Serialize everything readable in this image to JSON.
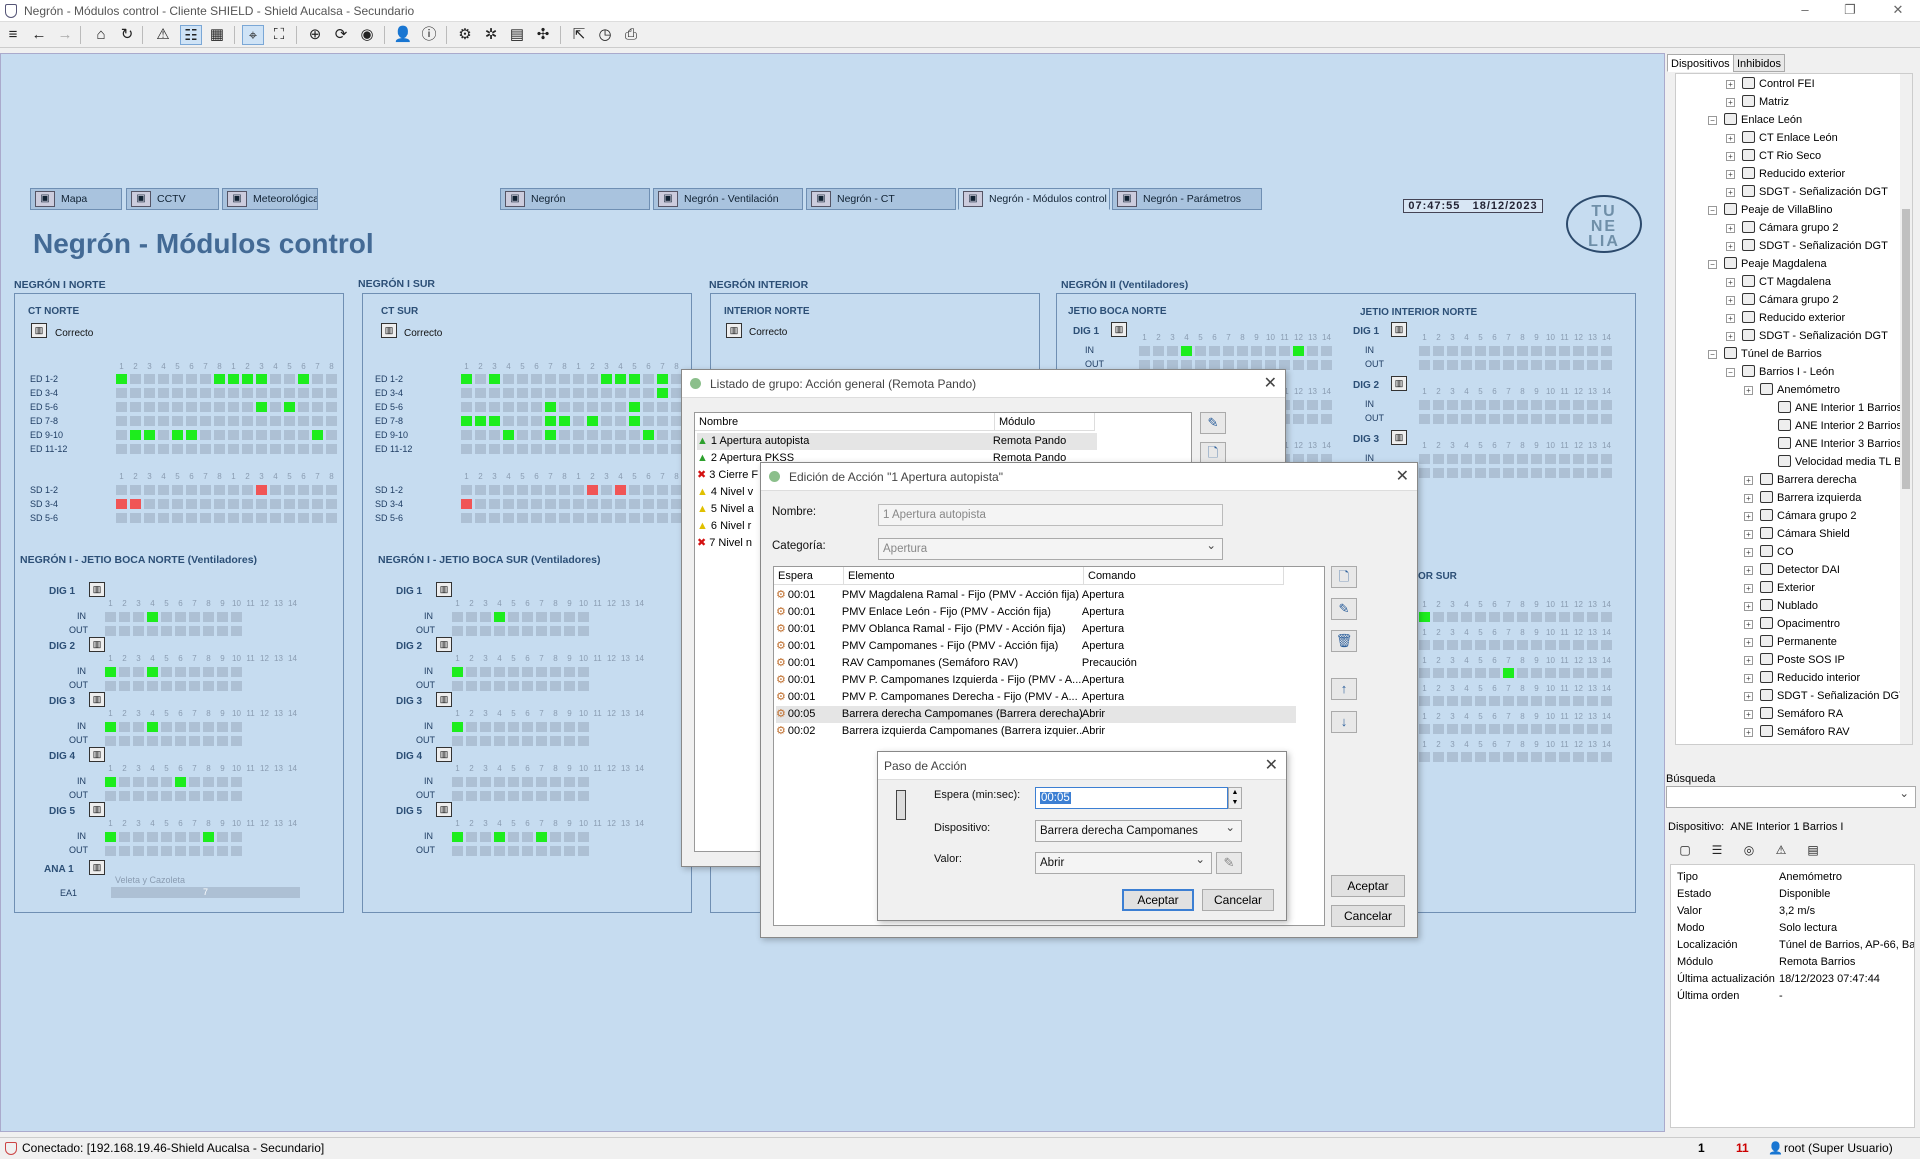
{
  "window": {
    "title": "Negrón - Módulos control - Cliente SHIELD - Shield Aucalsa - Secundario"
  },
  "tabs": [
    {
      "label": "Mapa",
      "icon": "map-icon"
    },
    {
      "label": "CCTV",
      "icon": "camera-icon"
    },
    {
      "label": "Meteorológicas",
      "icon": "weather-icon"
    },
    {
      "label": "Negrón",
      "icon": "module-icon"
    },
    {
      "label": "Negrón - Ventilación",
      "icon": "fan-icon"
    },
    {
      "label": "Negrón - CT",
      "icon": "module-icon"
    },
    {
      "label": "Negrón - Módulos control",
      "icon": "module-icon",
      "active": true
    },
    {
      "label": "Negrón - Parámetros",
      "icon": "gear-icon"
    }
  ],
  "clock": {
    "time": "07:47:55",
    "date": "18/12/2023"
  },
  "logo": {
    "line1": "TU",
    "line2": "NE",
    "line3": "LIA"
  },
  "page": {
    "title": "Negrón - Módulos control"
  },
  "sections": {
    "norte": "NEGRÓN I NORTE",
    "sur": "NEGRÓN I SUR",
    "interior": "NEGRÓN INTERIOR",
    "ventiladores": "NEGRÓN II (Ventiladores)",
    "ct_norte": "CT NORTE",
    "ct_sur": "CT SUR",
    "interior_norte": "INTERIOR NORTE",
    "jetio_boca_norte": "JETIO BOCA NORTE",
    "jetio_interior_norte": "JETIO INTERIOR NORTE",
    "jetio_boca_norte_vent": "NEGRÓN I - JETIO BOCA NORTE (Ventiladores)",
    "jetio_boca_sur_vent": "NEGRÓN I - JETIO BOCA SUR (Ventiladores)",
    "or_sur": "OR SUR",
    "status_ok": "Correcto"
  },
  "ed_header": [
    "1",
    "2",
    "3",
    "4",
    "5",
    "6",
    "7",
    "8",
    "1",
    "2",
    "3",
    "4",
    "5",
    "6",
    "7",
    "8"
  ],
  "dig_header": [
    "1",
    "2",
    "3",
    "4",
    "5",
    "6",
    "7",
    "8",
    "9",
    "10",
    "11",
    "12",
    "13",
    "14"
  ],
  "ct_norte": {
    "ed": [
      {
        "label": "ED 1-2",
        "cells": "g......gggg..g.."
      },
      {
        "label": "ED 3-4",
        "cells": "................"
      },
      {
        "label": "ED 5-6",
        "cells": "..........g.g..."
      },
      {
        "label": "ED 7-8",
        "cells": "................gg"
      },
      {
        "label": "ED 9-10",
        "cells": ".gg.gg........g."
      },
      {
        "label": "ED 11-12",
        "cells": "................"
      }
    ],
    "sd": [
      {
        "label": "SD 1-2",
        "cells": "..........r....."
      },
      {
        "label": "SD 3-4",
        "cells": "rr.............."
      },
      {
        "label": "SD 5-6",
        "cells": "................"
      }
    ]
  },
  "ct_sur": {
    "ed": [
      {
        "label": "ED 1-2",
        "cells": "g.g.......ggg.g."
      },
      {
        "label": "ED 3-4",
        "cells": "..............g."
      },
      {
        "label": "ED 5-6",
        "cells": "......g.....g..."
      },
      {
        "label": "ED 7-8",
        "cells": "ggg...gg.g..g..."
      },
      {
        "label": "ED 9-10",
        "cells": "...g..g......g.."
      },
      {
        "label": "ED 11-12",
        "cells": "................"
      }
    ],
    "sd": [
      {
        "label": "SD 1-2",
        "cells": ".........r.r...."
      },
      {
        "label": "SD 3-4",
        "cells": "r..............."
      },
      {
        "label": "SD 5-6",
        "cells": "................"
      }
    ]
  },
  "vent_norte": [
    {
      "label": "DIG 1",
      "in": "...g......",
      "out": ".........."
    },
    {
      "label": "DIG 2",
      "in": "g..g......",
      "out": ".........."
    },
    {
      "label": "DIG 3",
      "in": "g..g......",
      "out": ".........."
    },
    {
      "label": "DIG 4",
      "in": "g....g....",
      "out": ".........."
    },
    {
      "label": "DIG 5",
      "in": "g......g..",
      "out": ".........."
    }
  ],
  "vent_sur": [
    {
      "label": "DIG 1",
      "in": "...g......",
      "out": ".........."
    },
    {
      "label": "DIG 2",
      "in": "g.........",
      "out": ".........."
    },
    {
      "label": "DIG 3",
      "in": "g.........",
      "out": ".........."
    },
    {
      "label": "DIG 4",
      "in": "..........",
      "out": ".........."
    },
    {
      "label": "DIG 5",
      "in": "g..g..g...",
      "out": ".........."
    }
  ],
  "io": {
    "in": "IN",
    "out": "OUT"
  },
  "ana": {
    "label": "ANA 1",
    "sub": "Veleta y Cazoleta",
    "row": "EA1",
    "value": "7"
  },
  "jetio_norte_digs": [
    "DIG 1",
    "DIG 2",
    "DIG 3"
  ],
  "listado": {
    "title": "Listado de grupo: Acción general (Remota Pando)",
    "cols": [
      "Nombre",
      "Módulo"
    ],
    "rows": [
      {
        "name": "1 Apertura autopista",
        "module": "Remota Pando",
        "icon": "up-arrow-icon"
      },
      {
        "name": "2 Apertura PKSS",
        "module": "Remota Pando",
        "icon": "up-arrow-icon"
      },
      {
        "name": "3 Cierre F",
        "module": "",
        "icon": "x-icon"
      },
      {
        "name": "4 Nivel v",
        "module": "",
        "icon": "warning-up-icon"
      },
      {
        "name": "5 Nivel a",
        "module": "",
        "icon": "warning-up-icon"
      },
      {
        "name": "6 Nivel r",
        "module": "",
        "icon": "warning-up-icon"
      },
      {
        "name": "7 Nivel n",
        "module": "",
        "icon": "x-icon"
      }
    ]
  },
  "edicion": {
    "title": "Edición de Acción \"1 Apertura autopista\"",
    "nombre_label": "Nombre:",
    "nombre_value": "1 Apertura autopista",
    "categoria_label": "Categoría:",
    "categoria_value": "Apertura",
    "cols": [
      "Espera",
      "Elemento",
      "Comando"
    ],
    "rows": [
      {
        "espera": "00:01",
        "elemento": "PMV Magdalena Ramal - Fijo (PMV - Acción fija)",
        "comando": "Apertura"
      },
      {
        "espera": "00:01",
        "elemento": "PMV Enlace León - Fijo (PMV - Acción fija)",
        "comando": "Apertura"
      },
      {
        "espera": "00:01",
        "elemento": "PMV Oblanca Ramal - Fijo (PMV - Acción fija)",
        "comando": "Apertura"
      },
      {
        "espera": "00:01",
        "elemento": "PMV Campomanes - Fijo (PMV - Acción fija)",
        "comando": "Apertura"
      },
      {
        "espera": "00:01",
        "elemento": "RAV Campomanes (Semáforo RAV)",
        "comando": "Precaución"
      },
      {
        "espera": "00:01",
        "elemento": "PMV P. Campomanes Izquierda - Fijo (PMV - A...",
        "comando": "Apertura"
      },
      {
        "espera": "00:01",
        "elemento": "PMV P. Campomanes Derecha - Fijo (PMV - A...",
        "comando": "Apertura"
      },
      {
        "espera": "00:05",
        "elemento": "Barrera derecha Campomanes (Barrera derecha)",
        "comando": "Abrir"
      },
      {
        "espera": "00:02",
        "elemento": "Barrera izquierda Campomanes (Barrera izquier...",
        "comando": "Abrir"
      }
    ],
    "accept": "Aceptar",
    "cancel": "Cancelar"
  },
  "paso": {
    "title": "Paso de Acción",
    "espera_label": "Espera (min:sec):",
    "espera_value": "00:05",
    "dispositivo_label": "Dispositivo:",
    "dispositivo_value": "Barrera derecha Campomanes",
    "valor_label": "Valor:",
    "valor_value": "Abrir",
    "accept": "Aceptar",
    "cancel": "Cancelar"
  },
  "right": {
    "tabs": [
      "Dispositivos",
      "Inhibidos"
    ],
    "tree": [
      {
        "label": "Control FEI",
        "level": 2
      },
      {
        "label": "Matriz",
        "level": 2
      },
      {
        "label": "Enlace León",
        "level": 1
      },
      {
        "label": "CT Enlace León",
        "level": 2
      },
      {
        "label": "CT Rio Seco",
        "level": 2
      },
      {
        "label": "Reducido exterior",
        "level": 2
      },
      {
        "label": "SDGT - Señalización DGT",
        "level": 2
      },
      {
        "label": "Peaje de VillaBlino",
        "level": 1
      },
      {
        "label": "Cámara grupo 2",
        "level": 2
      },
      {
        "label": "SDGT - Señalización DGT",
        "level": 2
      },
      {
        "label": "Peaje Magdalena",
        "level": 1
      },
      {
        "label": "CT Magdalena",
        "level": 2
      },
      {
        "label": "Cámara grupo 2",
        "level": 2
      },
      {
        "label": "Reducido exterior",
        "level": 2
      },
      {
        "label": "SDGT - Señalización DGT",
        "level": 2
      },
      {
        "label": "Túnel de Barrios",
        "level": 1
      },
      {
        "label": "Barrios I - León",
        "level": 2
      },
      {
        "label": "Anemómetro",
        "level": 3
      },
      {
        "label": "ANE Interior 1 Barrios I",
        "level": 4
      },
      {
        "label": "ANE Interior 2 Barrios I",
        "level": 4
      },
      {
        "label": "ANE Interior 3 Barrios I",
        "level": 4
      },
      {
        "label": "Velocidad media TL Barrios",
        "level": 4
      },
      {
        "label": "Barrera derecha",
        "level": 3
      },
      {
        "label": "Barrera izquierda",
        "level": 3
      },
      {
        "label": "Cámara grupo 2",
        "level": 3
      },
      {
        "label": "Cámara Shield",
        "level": 3
      },
      {
        "label": "CO",
        "level": 3
      },
      {
        "label": "Detector DAI",
        "level": 3
      },
      {
        "label": "Exterior",
        "level": 3
      },
      {
        "label": "Nublado",
        "level": 3
      },
      {
        "label": "Opacimentro",
        "level": 3
      },
      {
        "label": "Permanente",
        "level": 3
      },
      {
        "label": "Poste SOS IP",
        "level": 3
      },
      {
        "label": "Reducido interior",
        "level": 3
      },
      {
        "label": "SDGT - Señalización DGT",
        "level": 3
      },
      {
        "label": "Semáforo RA",
        "level": 3
      },
      {
        "label": "Semáforo RAV",
        "level": 3
      }
    ],
    "search_label": "Búsqueda",
    "device_label": "Dispositivo:",
    "device_value": "ANE Interior 1 Barrios I",
    "props": [
      {
        "k": "Tipo",
        "v": "Anemómetro"
      },
      {
        "k": "Estado",
        "v": "Disponible"
      },
      {
        "k": "Valor",
        "v": "3,2 m/s"
      },
      {
        "k": "Modo",
        "v": "Solo lectura"
      },
      {
        "k": "Localización",
        "v": "Túnel de Barrios, AP-66, Bar"
      },
      {
        "k": "Módulo",
        "v": "Remota Barrios"
      },
      {
        "k": "Última actualización",
        "v": "18/12/2023 07:47:44"
      },
      {
        "k": "Última orden",
        "v": "-"
      }
    ]
  },
  "status": {
    "connection": "Conectado: [192.168.19.46-Shield Aucalsa - Secundario]",
    "count1": "1",
    "count2": "11",
    "user": "root (Super Usuario)"
  }
}
